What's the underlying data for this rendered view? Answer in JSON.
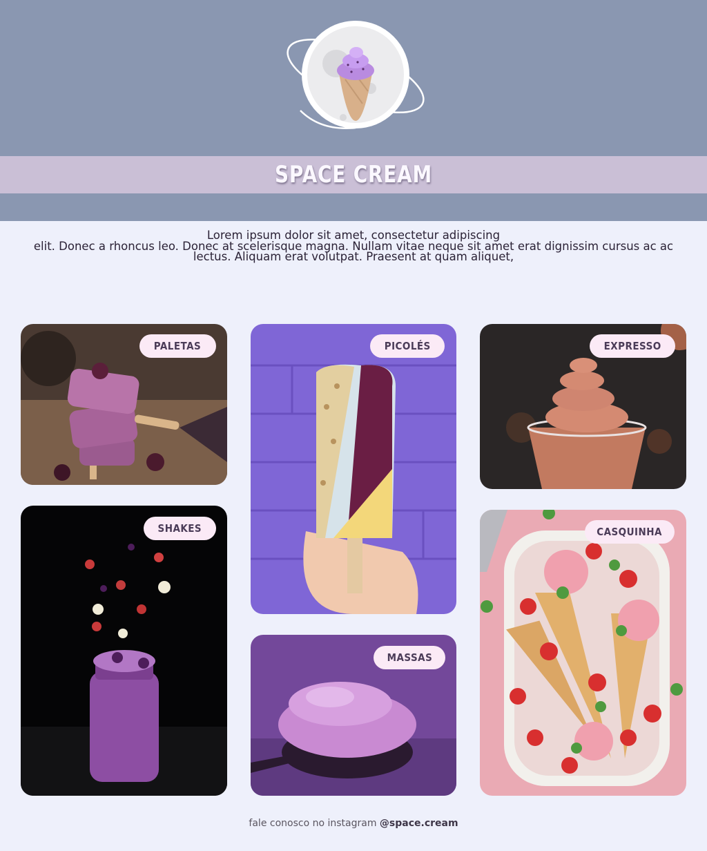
{
  "brand": {
    "name": "SPACE CREAM",
    "logo_icon": "ice-cream-planet-icon"
  },
  "intro": {
    "line1": "Lorem ipsum dolor sit amet, consectetur adipiscing",
    "line2": "elit. Donec a rhoncus leo. Donec at scelerisque magna. Nullam vitae neque sit amet erat dignissim cursus ac ac",
    "line3": "lectus. Aliquam erat volutpat. Praesent at quam aliquet,"
  },
  "categories": [
    {
      "label": "PALETAS"
    },
    {
      "label": "PICOLÉS"
    },
    {
      "label": "EXPRESSO"
    },
    {
      "label": "SHAKES"
    },
    {
      "label": "MASSAS"
    },
    {
      "label": "CASQUINHA"
    }
  ],
  "footer": {
    "text": "fale conosco no instagram",
    "handle": "@space.cream"
  },
  "colors": {
    "header": "#8a97b1",
    "banner": "#cabfd6",
    "page": "#eef0fb",
    "pill": "#fbeaf6"
  }
}
